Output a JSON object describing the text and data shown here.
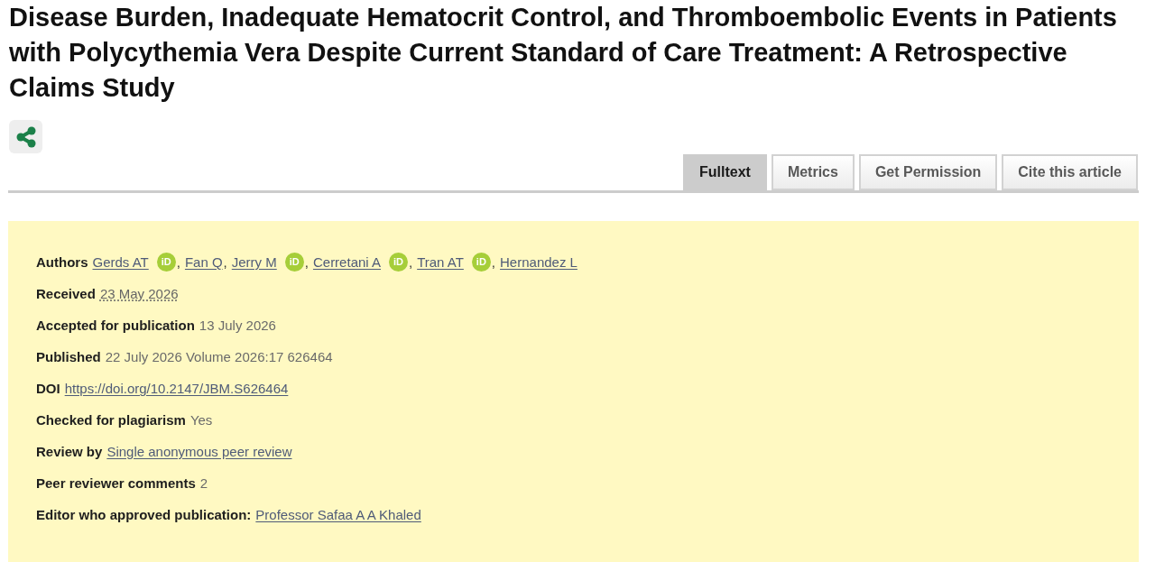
{
  "title": "Disease Burden, Inadequate Hematocrit Control, and Thromboembolic Events in Patients with Polycythemia Vera Despite Current Standard of Care Treatment: A Retrospective Claims Study",
  "tabs": [
    {
      "label": "Fulltext",
      "selected": true
    },
    {
      "label": "Metrics",
      "selected": false
    },
    {
      "label": "Get Permission",
      "selected": false
    },
    {
      "label": "Cite this article",
      "selected": false
    }
  ],
  "details": [
    {
      "kind": "authors",
      "label": "Authors",
      "authors": [
        {
          "name": "Gerds AT",
          "badge": "iD",
          "separator": ","
        },
        {
          "name": "Fan Q",
          "separator": ","
        },
        {
          "name": "Jerry M",
          "badge": "iD",
          "separator": ","
        },
        {
          "name": "Cerretani A",
          "badge": "iD",
          "separator": ","
        },
        {
          "name": "Tran AT",
          "badge": "iD",
          "separator": ","
        },
        {
          "name": "Hernandez L"
        }
      ]
    },
    {
      "kind": "abbr",
      "label": "Received",
      "value": "23 May 2026"
    },
    {
      "kind": "text",
      "label": "Accepted for publication",
      "value": "13 July 2026"
    },
    {
      "kind": "text",
      "label": "Published",
      "value": "22 July 2026 Volume 2026:17 626464"
    },
    {
      "kind": "link",
      "label": "DOI",
      "value": "https://doi.org/10.2147/JBM.S626464"
    },
    {
      "kind": "text",
      "label": "Checked for plagiarism",
      "value": "Yes"
    },
    {
      "kind": "link",
      "label": "Review by",
      "value": "Single anonymous peer review"
    },
    {
      "kind": "text",
      "label": "Peer reviewer comments",
      "value": "2"
    },
    {
      "kind": "link",
      "label": "Editor who approved publication:",
      "value": "Professor Safaa A A Khaled"
    }
  ]
}
